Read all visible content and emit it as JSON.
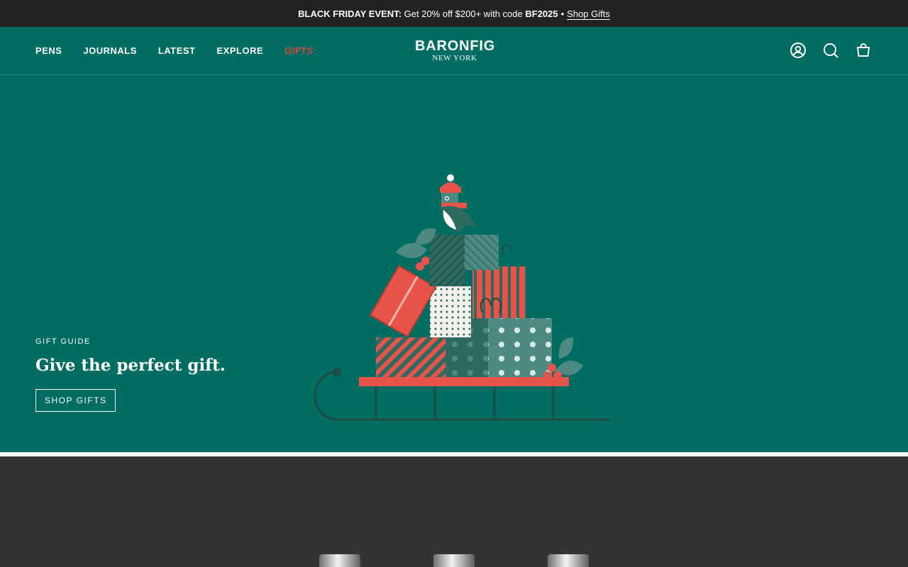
{
  "announcement": {
    "prefix": "BLACK FRIDAY EVENT:",
    "text": "Get 20% off $200+ with code",
    "code": "BF2025",
    "separator": "•",
    "link": "Shop Gifts"
  },
  "nav": {
    "items": [
      {
        "label": "PENS"
      },
      {
        "label": "JOURNALS"
      },
      {
        "label": "LATEST"
      },
      {
        "label": "EXPLORE"
      },
      {
        "label": "GIFTS"
      }
    ]
  },
  "logo": {
    "main": "BARONFIG",
    "sub": "NEW YORK"
  },
  "header_icons": [
    "account-icon",
    "search-icon",
    "cart-icon"
  ],
  "hero": {
    "eyebrow": "GIFT GUIDE",
    "headline": "Give the perfect gift.",
    "button": "SHOP GIFTS"
  },
  "colors": {
    "brand_green": "#006d62",
    "accent_red": "#d8453a",
    "announcement_bg": "#222222",
    "section_dark": "#333333"
  }
}
